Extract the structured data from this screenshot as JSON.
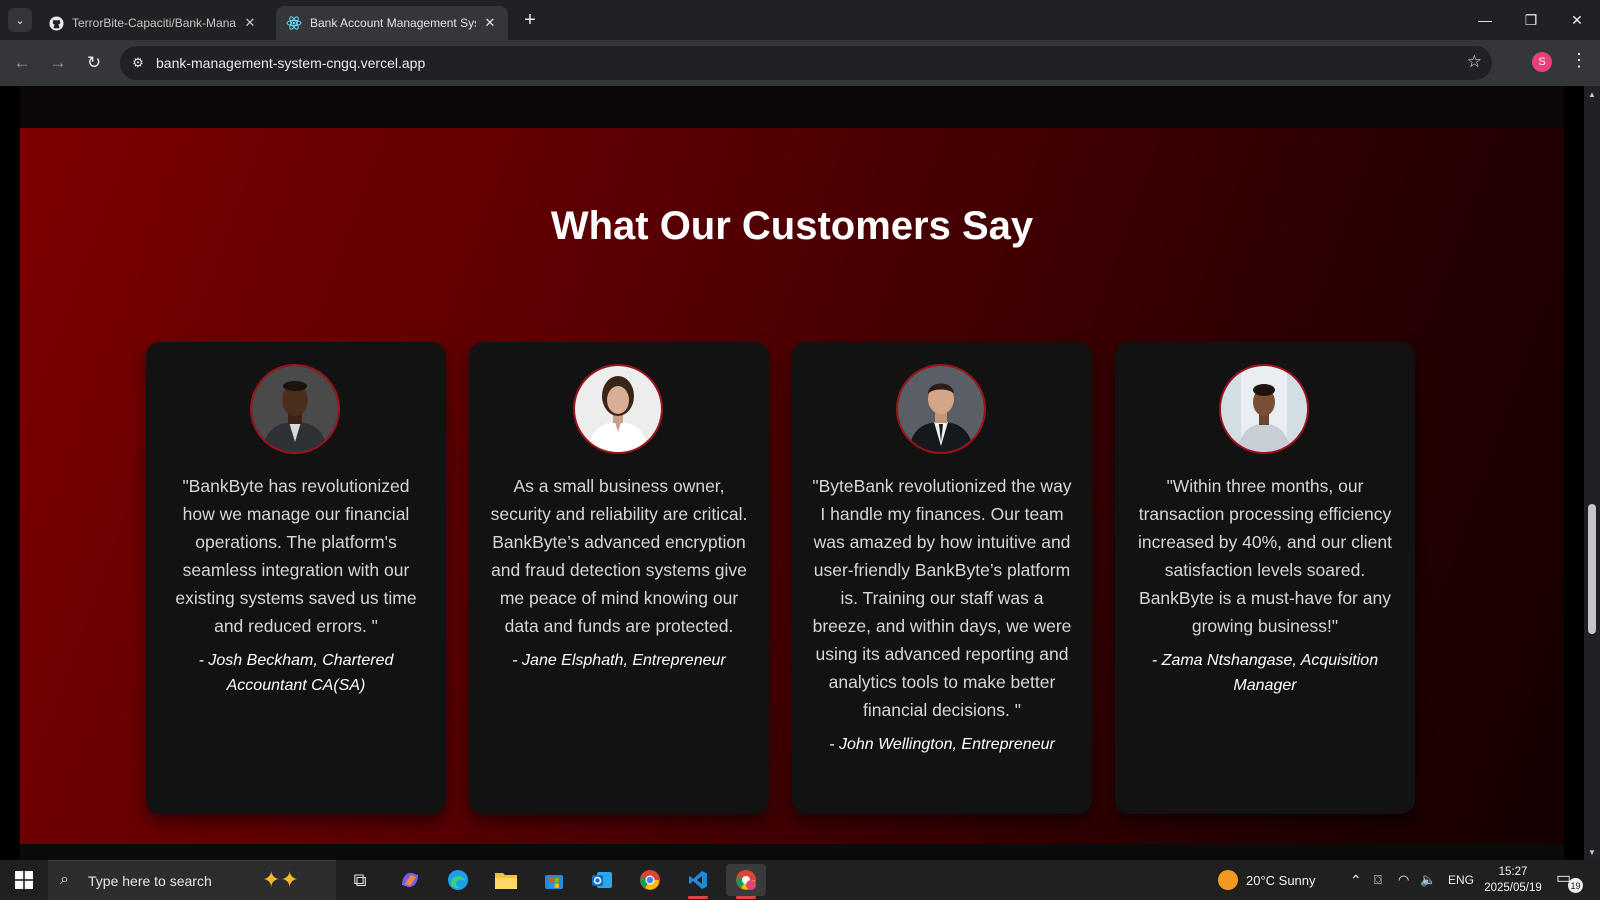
{
  "browser": {
    "tabs": [
      {
        "title": "TerrorBite-Capaciti/Bank-Mana",
        "icon": "github-icon"
      },
      {
        "title": "Bank Account Management Sys",
        "icon": "react-icon"
      }
    ],
    "url": "bank-management-system-cngq.vercel.app",
    "profile_initial": "S"
  },
  "section": {
    "title": "What Our Customers Say"
  },
  "testimonials": [
    {
      "quote": "\"BankByte has revolutionized how we manage our financial operations. The platform's seamless integration with our existing systems saved us time and reduced errors. \"",
      "author": "- Josh Beckham, Chartered Accountant CA(SA)"
    },
    {
      "quote": "As a small business owner, security and reliability are critical. BankByte’s advanced encryption and fraud detection systems give me peace of mind knowing our data and funds are protected.",
      "author": "- Jane Elsphath, Entrepreneur"
    },
    {
      "quote": "\"ByteBank revolutionized the way I handle my finances. Our team was amazed by how intuitive and user-friendly BankByte’s platform is. Training our staff was a breeze, and within days, we were using its advanced reporting and analytics tools to make better financial decisions. \"",
      "author": "- John Wellington, Entrepreneur"
    },
    {
      "quote": "\"Within three months, our transaction processing efficiency increased by 40%, and our client satisfaction levels soared. BankByte is a must-have for any growing business!\"",
      "author": "- Zama Ntshangase, Acquisition Manager"
    }
  ],
  "taskbar": {
    "search_placeholder": "Type here to search",
    "weather": "20°C  Sunny",
    "language": "ENG",
    "time": "15:27",
    "date": "2025/05/19",
    "notification_count": "19"
  }
}
